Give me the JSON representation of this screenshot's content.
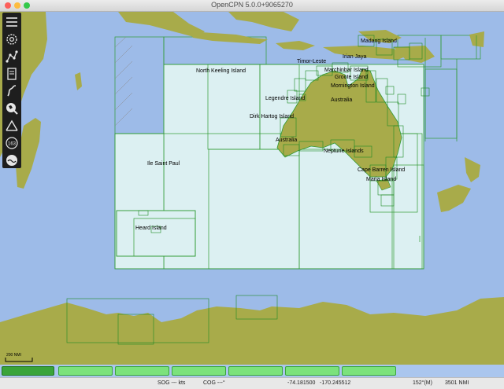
{
  "window": {
    "title": "OpenCPN 5.0.0+9065270",
    "colors": {
      "close": "#fc605b",
      "minimize": "#fdbc40",
      "zoom": "#34c84a"
    }
  },
  "colors": {
    "sea": "#9dbbe8",
    "land": "#a8ab4a",
    "coverage": "#dcf0f2",
    "coverage_stroke": "#2f9a32"
  },
  "toolbar": {
    "items": [
      {
        "name": "menu-icon"
      },
      {
        "name": "settings-gear-icon"
      },
      {
        "name": "route-icon"
      },
      {
        "name": "route-manager-icon"
      },
      {
        "name": "track-icon"
      },
      {
        "name": "zoom-globe-icon"
      },
      {
        "name": "measure-icon"
      },
      {
        "name": "ais-icon"
      },
      {
        "name": "tide-current-icon"
      }
    ],
    "ais_label": "163"
  },
  "chart_labels": {
    "north_keeling": "North Keeling Island",
    "timor_leste": "Timor-Leste",
    "irian_jaya": "Irian Jaya",
    "madang": "Madang Island",
    "marchinbar": "Marchinbar Island",
    "groote": "Groote Island",
    "mornington": "Mornington Island",
    "legendre": "Legendre Island",
    "australia_north": "Australia",
    "dirk_hartog": "Dirk Hartog Island",
    "australia_west": "Australia",
    "neptune": "Neptune Islands",
    "ile_saint_paul": "Ile Saint Paul",
    "cape_barren": "Cape Barren Island",
    "maria": "Maria Island",
    "heard": "Heard Island"
  },
  "scale": {
    "label": "200 NMI"
  },
  "piano": {
    "keys": 7,
    "active_index": 0
  },
  "status": {
    "sog": "SOG --- kts",
    "cog": "COG ---°",
    "lat": "-74.181500",
    "lon": "-170.245512",
    "bearing": "152°(M)",
    "distance": "3501 NMI"
  }
}
